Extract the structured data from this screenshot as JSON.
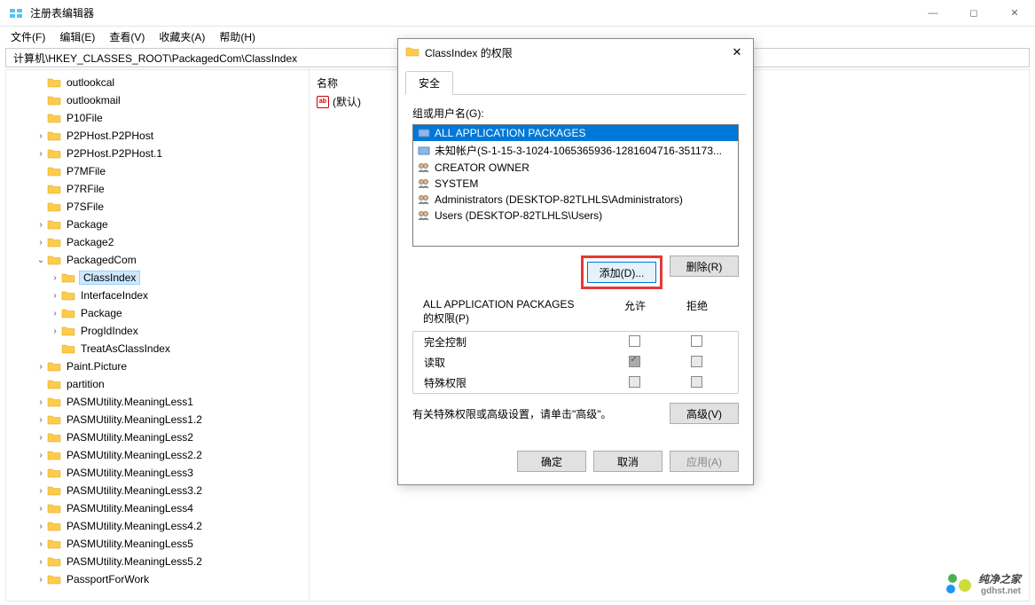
{
  "window": {
    "title": "注册表编辑器",
    "min_icon": "—",
    "max_icon": "◻",
    "close_icon": "✕"
  },
  "menu": [
    "文件(F)",
    "编辑(E)",
    "查看(V)",
    "收藏夹(A)",
    "帮助(H)"
  ],
  "address": "计算机\\HKEY_CLASSES_ROOT\\PackagedCom\\ClassIndex",
  "tree": [
    {
      "level": 2,
      "expandable": false,
      "label": "outlookcal"
    },
    {
      "level": 2,
      "expandable": false,
      "label": "outlookmail"
    },
    {
      "level": 2,
      "expandable": false,
      "label": "P10File"
    },
    {
      "level": 2,
      "expandable": true,
      "label": "P2PHost.P2PHost"
    },
    {
      "level": 2,
      "expandable": true,
      "label": "P2PHost.P2PHost.1"
    },
    {
      "level": 2,
      "expandable": false,
      "label": "P7MFile"
    },
    {
      "level": 2,
      "expandable": false,
      "label": "P7RFile"
    },
    {
      "level": 2,
      "expandable": false,
      "label": "P7SFile"
    },
    {
      "level": 2,
      "expandable": true,
      "label": "Package"
    },
    {
      "level": 2,
      "expandable": true,
      "label": "Package2"
    },
    {
      "level": 2,
      "expandable": true,
      "expanded": true,
      "label": "PackagedCom"
    },
    {
      "level": 3,
      "expandable": true,
      "label": "ClassIndex",
      "selected": true
    },
    {
      "level": 3,
      "expandable": true,
      "label": "InterfaceIndex"
    },
    {
      "level": 3,
      "expandable": true,
      "label": "Package"
    },
    {
      "level": 3,
      "expandable": true,
      "label": "ProgIdIndex"
    },
    {
      "level": 3,
      "expandable": false,
      "label": "TreatAsClassIndex"
    },
    {
      "level": 2,
      "expandable": true,
      "label": "Paint.Picture"
    },
    {
      "level": 2,
      "expandable": false,
      "label": "partition"
    },
    {
      "level": 2,
      "expandable": true,
      "label": "PASMUtility.MeaningLess1"
    },
    {
      "level": 2,
      "expandable": true,
      "label": "PASMUtility.MeaningLess1.2"
    },
    {
      "level": 2,
      "expandable": true,
      "label": "PASMUtility.MeaningLess2"
    },
    {
      "level": 2,
      "expandable": true,
      "label": "PASMUtility.MeaningLess2.2"
    },
    {
      "level": 2,
      "expandable": true,
      "label": "PASMUtility.MeaningLess3"
    },
    {
      "level": 2,
      "expandable": true,
      "label": "PASMUtility.MeaningLess3.2"
    },
    {
      "level": 2,
      "expandable": true,
      "label": "PASMUtility.MeaningLess4"
    },
    {
      "level": 2,
      "expandable": true,
      "label": "PASMUtility.MeaningLess4.2"
    },
    {
      "level": 2,
      "expandable": true,
      "label": "PASMUtility.MeaningLess5"
    },
    {
      "level": 2,
      "expandable": true,
      "label": "PASMUtility.MeaningLess5.2"
    },
    {
      "level": 2,
      "expandable": true,
      "label": "PassportForWork"
    }
  ],
  "detail": {
    "header_name": "名称",
    "default_value_name": "(默认)"
  },
  "dialog": {
    "title": "ClassIndex 的权限",
    "tab": "安全",
    "group_label": "组或用户名(G):",
    "groups": [
      {
        "icon": "pkg",
        "label": "ALL APPLICATION PACKAGES",
        "selected": true
      },
      {
        "icon": "pkg",
        "label": "未知帐户(S-1-15-3-1024-1065365936-1281604716-351173..."
      },
      {
        "icon": "users",
        "label": "CREATOR OWNER"
      },
      {
        "icon": "users",
        "label": "SYSTEM"
      },
      {
        "icon": "users",
        "label": "Administrators (DESKTOP-82TLHLS\\Administrators)"
      },
      {
        "icon": "users",
        "label": "Users (DESKTOP-82TLHLS\\Users)"
      }
    ],
    "btn_add": "添加(D)...",
    "btn_remove": "删除(R)",
    "perm_title_1": "ALL APPLICATION PACKAGES",
    "perm_title_2": "的权限(P)",
    "hcol_allow": "允许",
    "hcol_deny": "拒绝",
    "perms": [
      {
        "name": "完全控制",
        "allow": false,
        "deny": false,
        "grey": false
      },
      {
        "name": "读取",
        "allow": true,
        "deny": false,
        "grey": true
      },
      {
        "name": "特殊权限",
        "allow": false,
        "deny": false,
        "grey": true
      }
    ],
    "adv_text": "有关特殊权限或高级设置，请单击\"高级\"。",
    "btn_adv": "高级(V)",
    "btn_ok": "确定",
    "btn_cancel": "取消",
    "btn_apply": "应用(A)"
  },
  "watermark": {
    "name": "纯净之家",
    "sub": "gdhst.net"
  }
}
